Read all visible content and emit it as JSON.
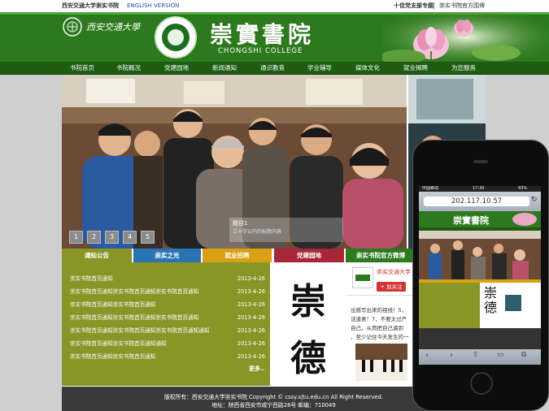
{
  "topbar": {
    "school_link": "西安交通大学崇实书院",
    "english_link": "ENGLISH VERSION",
    "special_link": "十佳党支部专题",
    "weibo_link": "崇实书院官方围博"
  },
  "header": {
    "university_logo_text": "西安交通大學",
    "title_cn": "崇實書院",
    "title_en": "CHONGSHI  COLLEGE"
  },
  "nav": {
    "items": [
      "书院首页",
      "书院概况",
      "党建园地",
      "新闻通知",
      "通识教育",
      "学业辅导",
      "媒体文化",
      "就业揭聘",
      "为您服务"
    ]
  },
  "slider": {
    "caption_title": "题目1",
    "caption_sub": "三十字以内的标题内容",
    "pages": [
      "1",
      "2",
      "3",
      "4",
      "5"
    ]
  },
  "tabs": [
    "通知公告",
    "崇实之光",
    "就业招聘",
    "党建园地",
    "崇实书院官方微博"
  ],
  "news": {
    "items": [
      {
        "title": "崇实书院首页通知",
        "date": "2013-4-26"
      },
      {
        "title": "崇实书院首页通知崇实书院首页通知崇实书院首页通知",
        "date": "2013-4-26"
      },
      {
        "title": "崇实书院首页通知崇实书院首页通知",
        "date": "2013-4-26"
      },
      {
        "title": "崇实书院首页通知崇实书院首页通知崇实书院首页通知",
        "date": "2013-4-26"
      },
      {
        "title": "崇实书院首页通知崇实书院首页通知崇实书院首页通知通知",
        "date": "2013-4-26"
      },
      {
        "title": "崇实书院首页通知崇实书院首页通知通知",
        "date": "2013-4-26"
      },
      {
        "title": "崇实书院首页通知崇实书院首页通知",
        "date": "2013-4-26"
      }
    ],
    "more": "更多.."
  },
  "calligraphy": {
    "char1": "崇",
    "char2": "德"
  },
  "weibo": {
    "name": "崇实交通大学",
    "follow": "+ 加关注",
    "text1": "出感写出来的祖线！5，",
    "text2": "话道意！7，不要太过严",
    "text3": "自己，从而把自己逼到",
    "text4": "，至少记住今天发生的一"
  },
  "footer": {
    "line1": "版权所有：西安交通大学崇实书院 Copyright © cssy.xjtu.edu.cn All Right Reserved.",
    "line2": "地址：陕西省西安市咸宁西路28号 邮编：710049"
  },
  "phone": {
    "carrier": "中国移动",
    "time": "17:30",
    "battery": "93%",
    "url": "202.117.10.57",
    "mini_title": "崇實書院"
  }
}
